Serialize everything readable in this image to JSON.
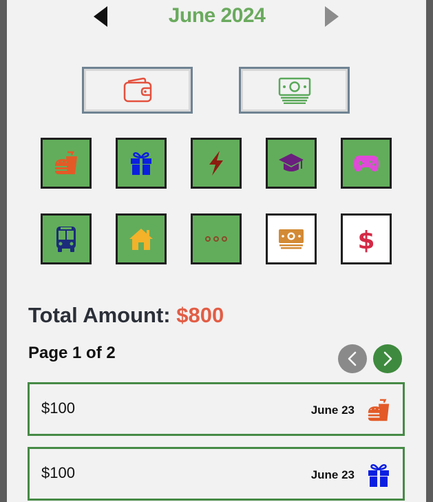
{
  "header": {
    "month_title": "June 2024",
    "prev_icon": "caret-left-icon",
    "next_icon": "caret-right-icon"
  },
  "type_toggle": {
    "expense_icon": "wallet-icon",
    "income_icon": "banknote-stack-icon"
  },
  "categories": [
    {
      "icon": "food-drink-icon",
      "color": "#e35a27",
      "selected": true
    },
    {
      "icon": "gift-icon",
      "color": "#0b1fe0",
      "selected": true
    },
    {
      "icon": "lightning-bolt-icon",
      "color": "#8b1d10",
      "selected": true
    },
    {
      "icon": "graduation-cap-icon",
      "color": "#6a1e7d",
      "selected": true
    },
    {
      "icon": "gamepad-icon",
      "color": "#e04ad8",
      "selected": true
    },
    {
      "icon": "bus-icon",
      "color": "#1b2c7a",
      "selected": true
    },
    {
      "icon": "home-icon",
      "color": "#f3b229",
      "selected": true
    },
    {
      "icon": "more-dots-icon",
      "color": "#8a4a2a",
      "selected": true
    },
    {
      "icon": "banknote-stack-icon",
      "color": "#d38a35",
      "selected": false
    },
    {
      "icon": "dollar-sign-icon",
      "color": "#d42a46",
      "selected": false
    }
  ],
  "summary": {
    "total_label": "Total Amount: ",
    "total_value": "$800",
    "total_color": "#e25d45"
  },
  "pagination": {
    "label": "Page 1 of 2"
  },
  "transactions": [
    {
      "amount": "$100",
      "date": "June 23",
      "icon": "food-drink-icon"
    },
    {
      "amount": "$100",
      "date": "June 23",
      "icon": "gift-icon"
    }
  ],
  "colors": {
    "accent_green": "#62ad5b",
    "title_green": "#6aaa5e",
    "border_green": "#468a46"
  }
}
